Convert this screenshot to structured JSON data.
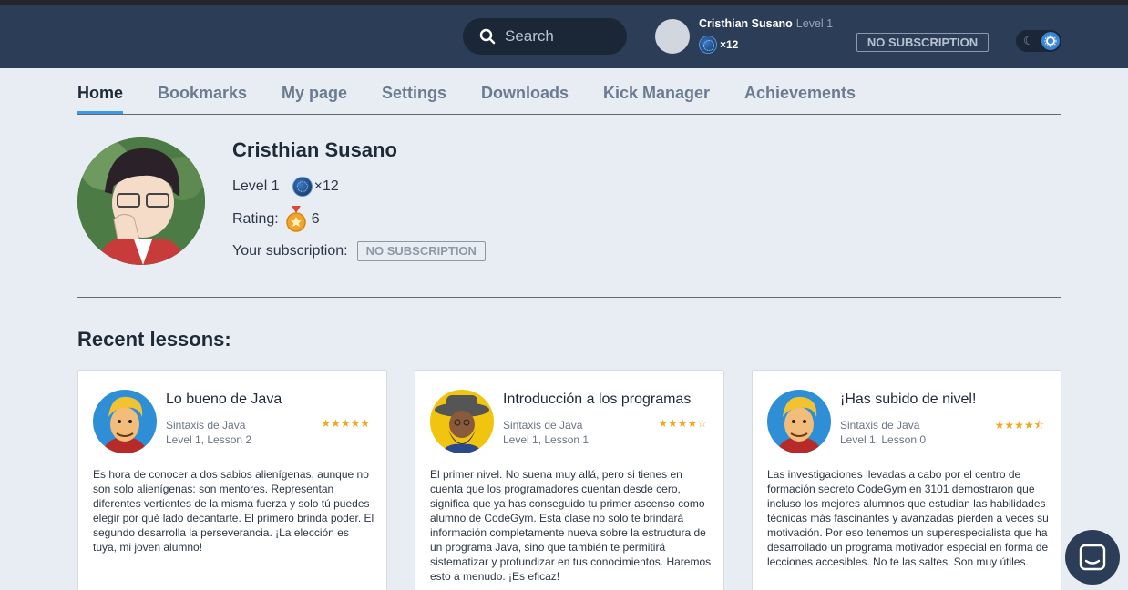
{
  "header": {
    "search_placeholder": "Search",
    "user_name": "Cristhian Susano",
    "user_level": "Level 1",
    "orbs": "×12",
    "subscription": "NO SUBSCRIPTION",
    "theme_icon": "moon-icon",
    "theme_knob_icon": "sun-icon"
  },
  "tabs": [
    {
      "label": "Home",
      "active": true
    },
    {
      "label": "Bookmarks"
    },
    {
      "label": "My page"
    },
    {
      "label": "Settings"
    },
    {
      "label": "Downloads"
    },
    {
      "label": "Kick Manager"
    },
    {
      "label": "Achievements"
    }
  ],
  "profile": {
    "name": "Cristhian Susano",
    "level": "Level 1",
    "orbs": "×12",
    "rating_label": "Rating:",
    "rating_value": "6",
    "subscription_label": "Your subscription:",
    "subscription_value": "NO SUBSCRIPTION"
  },
  "recent_title": "Recent lessons:",
  "lessons": [
    {
      "title": "Lo bueno de Java",
      "course": "Sintaxis de Java",
      "lesson": "Level 1, Lesson 2",
      "rating": 5,
      "text": "Es hora de conocer a dos sabios alienígenas, aunque no son solo alienígenas: son mentores. Representan diferentes vertientes de la misma fuerza y solo tú puedes elegir por qué lado decantarte. El primero brinda poder. El segundo desarrolla la perseverancia. ¡La elección es tuya, mi joven alumno!"
    },
    {
      "title": "Introducción a los programas",
      "course": "Sintaxis de Java",
      "lesson": "Level 1, Lesson 1",
      "rating": 4,
      "text": "El primer nivel. No suena muy allá, pero si tienes en cuenta que los programadores cuentan desde cero, significa que ya has conseguido tu primer ascenso como alumno de CodeGym. Esta clase no solo te brindará información completamente nueva sobre la estructura de un programa Java, sino que también te permitirá sistematizar y profundizar en tus conocimientos. Haremos esto a menudo. ¡Es eficaz!"
    },
    {
      "title": "¡Has subido de nivel!",
      "course": "Sintaxis de Java",
      "lesson": "Level 1, Lesson 0",
      "rating": 4.5,
      "text": "Las investigaciones llevadas a cabo por el centro de formación secreto CodeGym en 3101 demostraron que incluso los mejores alumnos que estudian las habilidades técnicas más fascinantes y avanzadas pierden a veces su motivación. Por eso tenemos un superespecialista que ha desarrollado un programa motivador especial en forma de lecciones accesibles. No te las saltes. Son muy útiles."
    }
  ],
  "chat_icon": "chat-icon"
}
